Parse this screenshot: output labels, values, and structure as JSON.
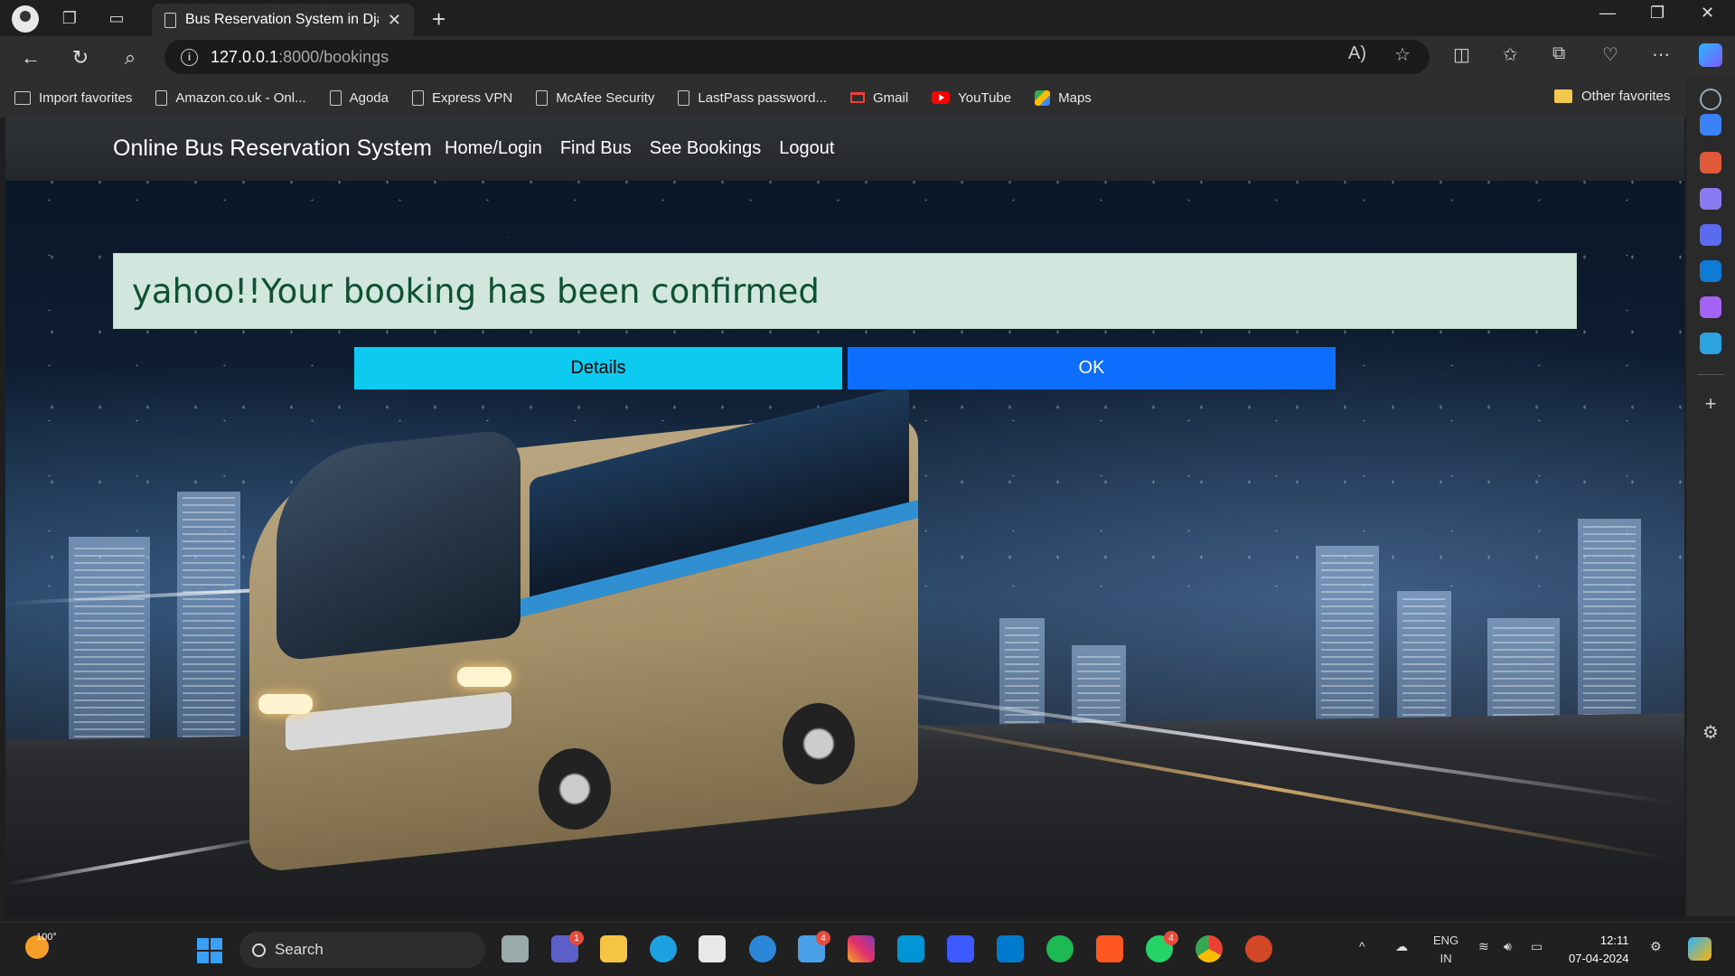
{
  "browser": {
    "tab_title": "Bus Reservation System in Djang",
    "tab_close": "✕",
    "new_tab": "+",
    "url_host": "127.0.0.1",
    "url_path": ":8000/bookings",
    "favorites": [
      {
        "label": "Import favorites",
        "icon": "import-icon"
      },
      {
        "label": "Amazon.co.uk - Onl...",
        "icon": "page-icon"
      },
      {
        "label": "Agoda",
        "icon": "page-icon"
      },
      {
        "label": "Express VPN",
        "icon": "page-icon"
      },
      {
        "label": "McAfee Security",
        "icon": "page-icon"
      },
      {
        "label": "LastPass password...",
        "icon": "page-icon"
      },
      {
        "label": "Gmail",
        "icon": "gmail-icon"
      },
      {
        "label": "YouTube",
        "icon": "youtube-icon"
      },
      {
        "label": "Maps",
        "icon": "maps-icon"
      }
    ],
    "other_favorites": "Other favorites"
  },
  "site": {
    "brand": "Online Bus Reservation System",
    "nav": [
      "Home/Login",
      "Find Bus",
      "See Bookings",
      "Logout"
    ],
    "alert": "yahoo!!Your booking has been confirmed",
    "details_button": "Details",
    "ok_button": "OK",
    "colors": {
      "alert_bg": "#d1e7dd",
      "alert_text": "#0f5132",
      "details": "#0dcaf0",
      "ok": "#0d6efd"
    }
  },
  "taskbar": {
    "temperature": "100°",
    "search_placeholder": "Search",
    "badges": {
      "teams": "1",
      "mail": "4",
      "whatsapp": "4"
    },
    "lang_top": "ENG",
    "lang_bottom": "IN",
    "time": "12:11",
    "date": "07-04-2024"
  }
}
